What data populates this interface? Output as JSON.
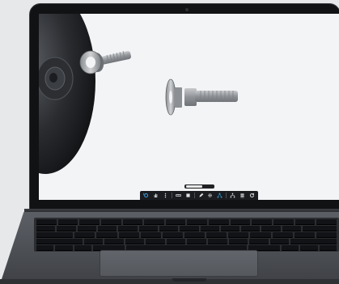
{
  "app": {
    "title": "",
    "scene": "3d-bolt-viewer"
  },
  "colors": {
    "screen_background": "#f3f4f5",
    "toolbar_background": "#1a1c1f",
    "toolbar_accent": "#3aa0e0",
    "laptop_body": "#4a4d52"
  },
  "viewer": {
    "objects": [
      {
        "name": "disc-wheel"
      },
      {
        "name": "bolt-with-washer-top"
      },
      {
        "name": "bolt-with-washer-center"
      }
    ],
    "zoom_level_fraction": 0.62
  },
  "toolbar": {
    "buttons": [
      {
        "icon": "rotate-icon"
      },
      {
        "icon": "hand-pan-icon"
      },
      {
        "icon": "vertical-dots-icon"
      },
      {
        "icon": "ruler-icon"
      },
      {
        "icon": "box-icon"
      },
      {
        "icon": "pencil-icon"
      },
      {
        "icon": "settings-icon"
      },
      {
        "icon": "network-icon"
      },
      {
        "icon": "tree-icon"
      },
      {
        "icon": "layers-icon"
      },
      {
        "icon": "refresh-icon"
      }
    ]
  }
}
